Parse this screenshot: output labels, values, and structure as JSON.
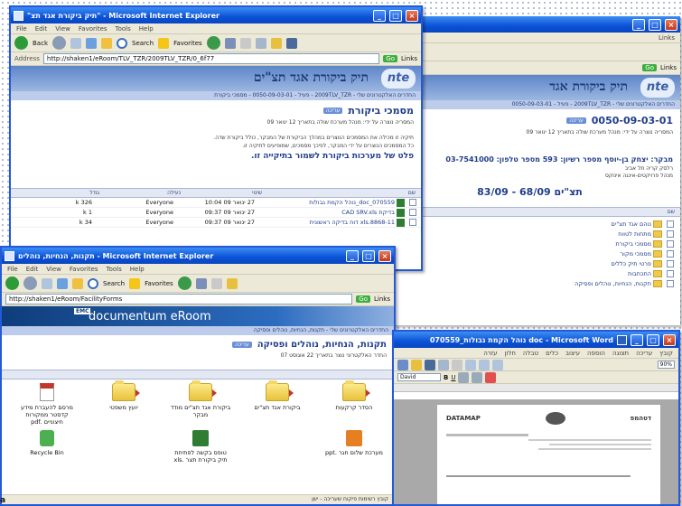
{
  "corner_letter": "a",
  "ie_menu": [
    "File",
    "Edit",
    "View",
    "Favorites",
    "Tools",
    "Help"
  ],
  "ie_toolbar": {
    "back": "Back",
    "search": "Search",
    "favorites": "Favorites",
    "go": "Go",
    "links": "Links"
  },
  "win_main": {
    "title": "\"תיק ביקורת אגד תצ\" - Microsoft Internet Explorer",
    "address": "http://shaken1/eRoom/TLV_TZR/2009TLV_TZR/0_6f77",
    "header_title": "תיק ביקורת אגד תצ\"ים",
    "logo": "nte",
    "breadcrumb": "החדרים האלקטרונים שלי - 2009TLV_TZR - פעיל - 0050-09-03-01 - מסמכי ביקורת",
    "section_title": "מסמכי ביקורת",
    "edit_pill": "עריכה",
    "created_by": "המסריה נוצרה על ידי: מנהל מערכת שולה בתאריך 12 ינואר 09",
    "desc1": "תיקיה זו מכילה את המסמכים הנוצרים במהלך הביקורת של המבקר, כולל ביקורת שדה.",
    "desc2": "כל המסמכים הנוצרים על ידי המבקר, לפיכך מסמכים, שמופיעים לתיקיה זו.",
    "red_note": "פלט של מערכות ביקורת לשמור בתיקייה זו.",
    "columns": [
      "שם",
      "שינוי",
      "נעילה",
      "גודל"
    ],
    "rows": [
      {
        "name": "doc_070559_נוהל הקמת גבולות",
        "date": "27 ינואר 09 10:04",
        "owner": "Everyone",
        "size": "k 326"
      },
      {
        "name": "בדיקת CAD SRV.xls",
        "date": "27 ינואר 09 09:37",
        "owner": "Everyone",
        "size": "k 1"
      },
      {
        "name": "xls.8868-11 דוח בדיקה ראשונית",
        "date": "27 ינואר 09 09:37",
        "owner": "Everyone",
        "size": "k 34"
      }
    ]
  },
  "win_right": {
    "header_title": "תיק ביקורת אגד",
    "logo": "nte",
    "breadcrumb": "החדרים האלקטרונים שלי - 2009TLV_TZR - פעיל - 0050-09-03-01",
    "record_title": "0050-09-03-01",
    "edit_pill": "עריכה",
    "created_by": "המסריה נוצרה על ידי: מנהל מערכת שולה בתאריך 12 ינואר 09",
    "auditor_line": "מבקר: יצחק בן-יוסף מספר רשיון: 593 מספר טלפון: 03-7541000",
    "sub1": "רלסק קריה תל אביב",
    "sub2": "מנהל פרויקטים-אינגה אינוקס",
    "period": "תצ\"ים 68/09 - 83/09",
    "col_name": "שם",
    "folders": [
      "נוהם אגד תצ\"ים",
      "מתחות לטווח",
      "מסמכי ביקורת",
      "מסמכי מקור",
      "פרטי תיק כללים",
      "התכתבות",
      "תקנות, הנחיות, נוהלים ופסיקה"
    ]
  },
  "win_erooms": {
    "title": "תקנות, הנחיות, נוהלים - Microsoft Internet Explorer",
    "address": "http://shaken1/eRoom/FacilityForms",
    "banner": "documentum eRoom",
    "banner_brand": "EMC",
    "breadcrumb": "החדרים האלקטרונים שלי - תקנות, הנחיות, נוהלים ופסיקה",
    "page_title": "תקנות, הנחיות, נוהלים ופסיקה",
    "edit_pill": "עריכה",
    "created_by": "החדר האלקטרוני נוצר בתאריך 22 אוגוסט 07",
    "items": [
      {
        "label": "הסדר קרקעות",
        "kind": "folder"
      },
      {
        "label": "ביקורת אגד תצ\"ים",
        "kind": "folder"
      },
      {
        "label": "ביקורת אגד תצ\"ים מודד מבקר",
        "kind": "folder"
      },
      {
        "label": "יועץ משפטי",
        "kind": "folder"
      },
      {
        "label": "מרסם להעברת מידע קדסטר ממקורות חיצוניים .pdf",
        "kind": "pdf"
      },
      {
        "label": "מערכת שלום חגר .ppt",
        "kind": "ppt"
      },
      {
        "label": "טופס בקשה לפתיחת תיק ביקורת תצר .xls",
        "kind": "xls"
      },
      {
        "label": "Recycle Bin",
        "kind": "recycle"
      }
    ],
    "status": "קובץ רשימות פיקוח שעריכה - ישן"
  },
  "win_word": {
    "title": "070559_נוהל הקמת גבולות doc - Microsoft Word",
    "menu": [
      "קובץ",
      "עריכה",
      "תצוגה",
      "הוספה",
      "עיצוב",
      "כלים",
      "טבלה",
      "חלון",
      "עזרה"
    ],
    "font": "David",
    "zoom": "90%",
    "doc_left": "DATAMAP",
    "doc_right": "דטהמפ"
  }
}
